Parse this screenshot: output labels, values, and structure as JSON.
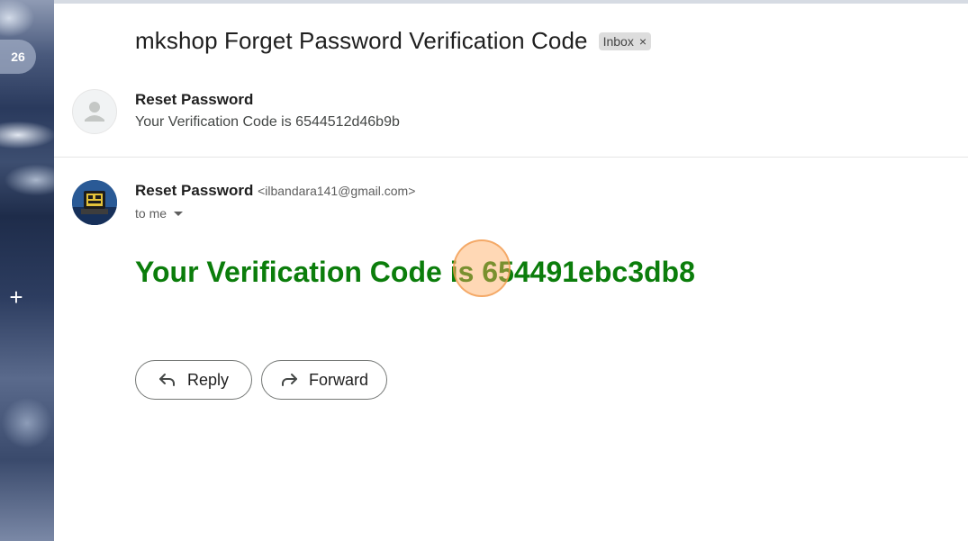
{
  "sidebar": {
    "unread_count": "26",
    "compose_icon": "plus-icon"
  },
  "thread": {
    "subject": "mkshop Forget Password Verification Code",
    "label_chip": "Inbox",
    "label_chip_remove": "×"
  },
  "messages": [
    {
      "sender": "Reset Password",
      "snippet": "Your Verification Code is 6544512d46b9b",
      "avatar": "default-person-icon"
    },
    {
      "sender": "Reset Password",
      "email": "<ilbandara141@gmail.com>",
      "to": "to me",
      "avatar": "profile-photo",
      "body": "Your Verification Code is 654491ebc3db8"
    }
  ],
  "actions": {
    "reply_label": "Reply",
    "forward_label": "Forward"
  },
  "colors": {
    "code_text": "#0b7d0b",
    "click_marker": "#ffa85a"
  }
}
